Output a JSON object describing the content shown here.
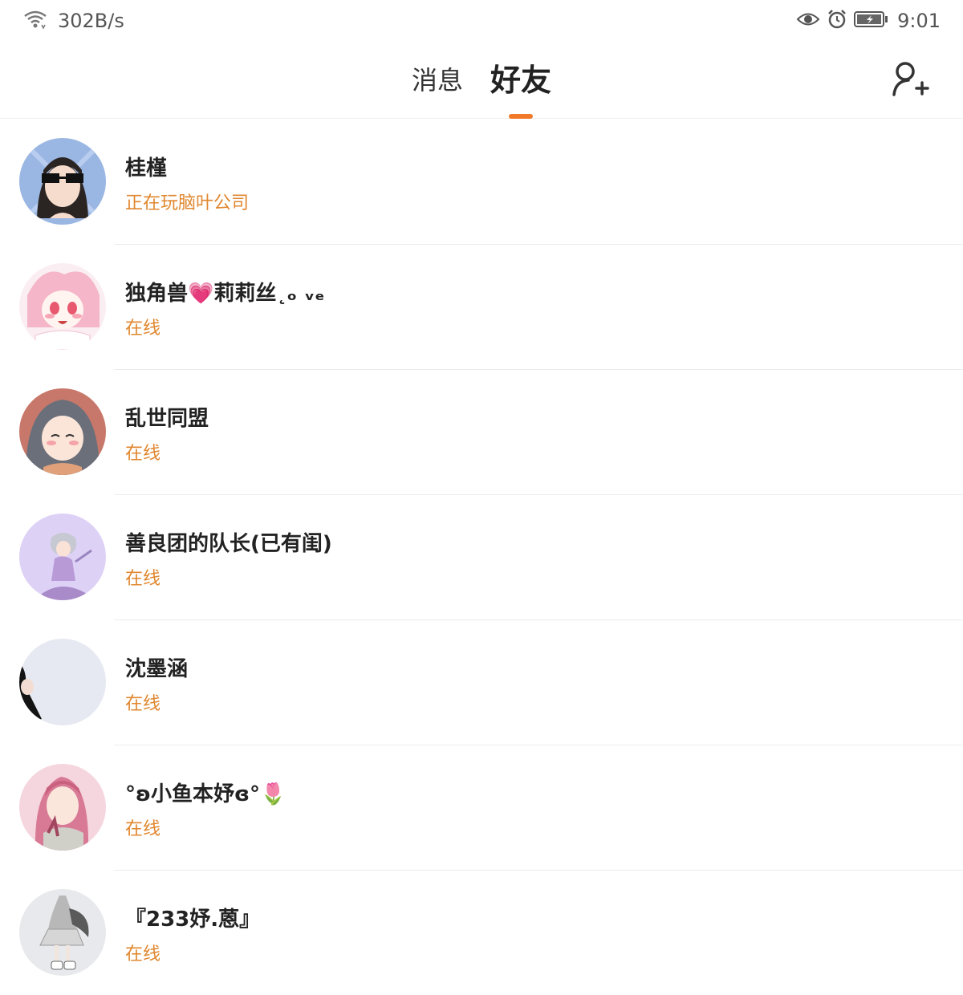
{
  "status_bar": {
    "network_speed": "302B/s",
    "time": "9:01",
    "icons": [
      "wifi-icon",
      "eye-icon",
      "alarm-icon",
      "battery-charging-icon"
    ]
  },
  "header": {
    "tabs": [
      {
        "label": "消息",
        "active": false
      },
      {
        "label": "好友",
        "active": true
      }
    ],
    "add_friend_icon": "add-friend-icon",
    "accent_color": "#f07a2a"
  },
  "friends": [
    {
      "name": "桂槿",
      "status": "正在玩脑叶公司"
    },
    {
      "name": "独角兽💗莉莉丝˛ₒ ᵥₑ",
      "status": "在线"
    },
    {
      "name": "乱世同盟",
      "status": "在线"
    },
    {
      "name": "善良团的队长(已有闺)",
      "status": "在线"
    },
    {
      "name": "沈墨涵",
      "status": "在线"
    },
    {
      "name": "°ʚ小鱼本妤ɞ°🌷",
      "status": "在线"
    },
    {
      "name": "『233妤.蒽』",
      "status": "在线"
    }
  ],
  "status_color": "#e0872f"
}
